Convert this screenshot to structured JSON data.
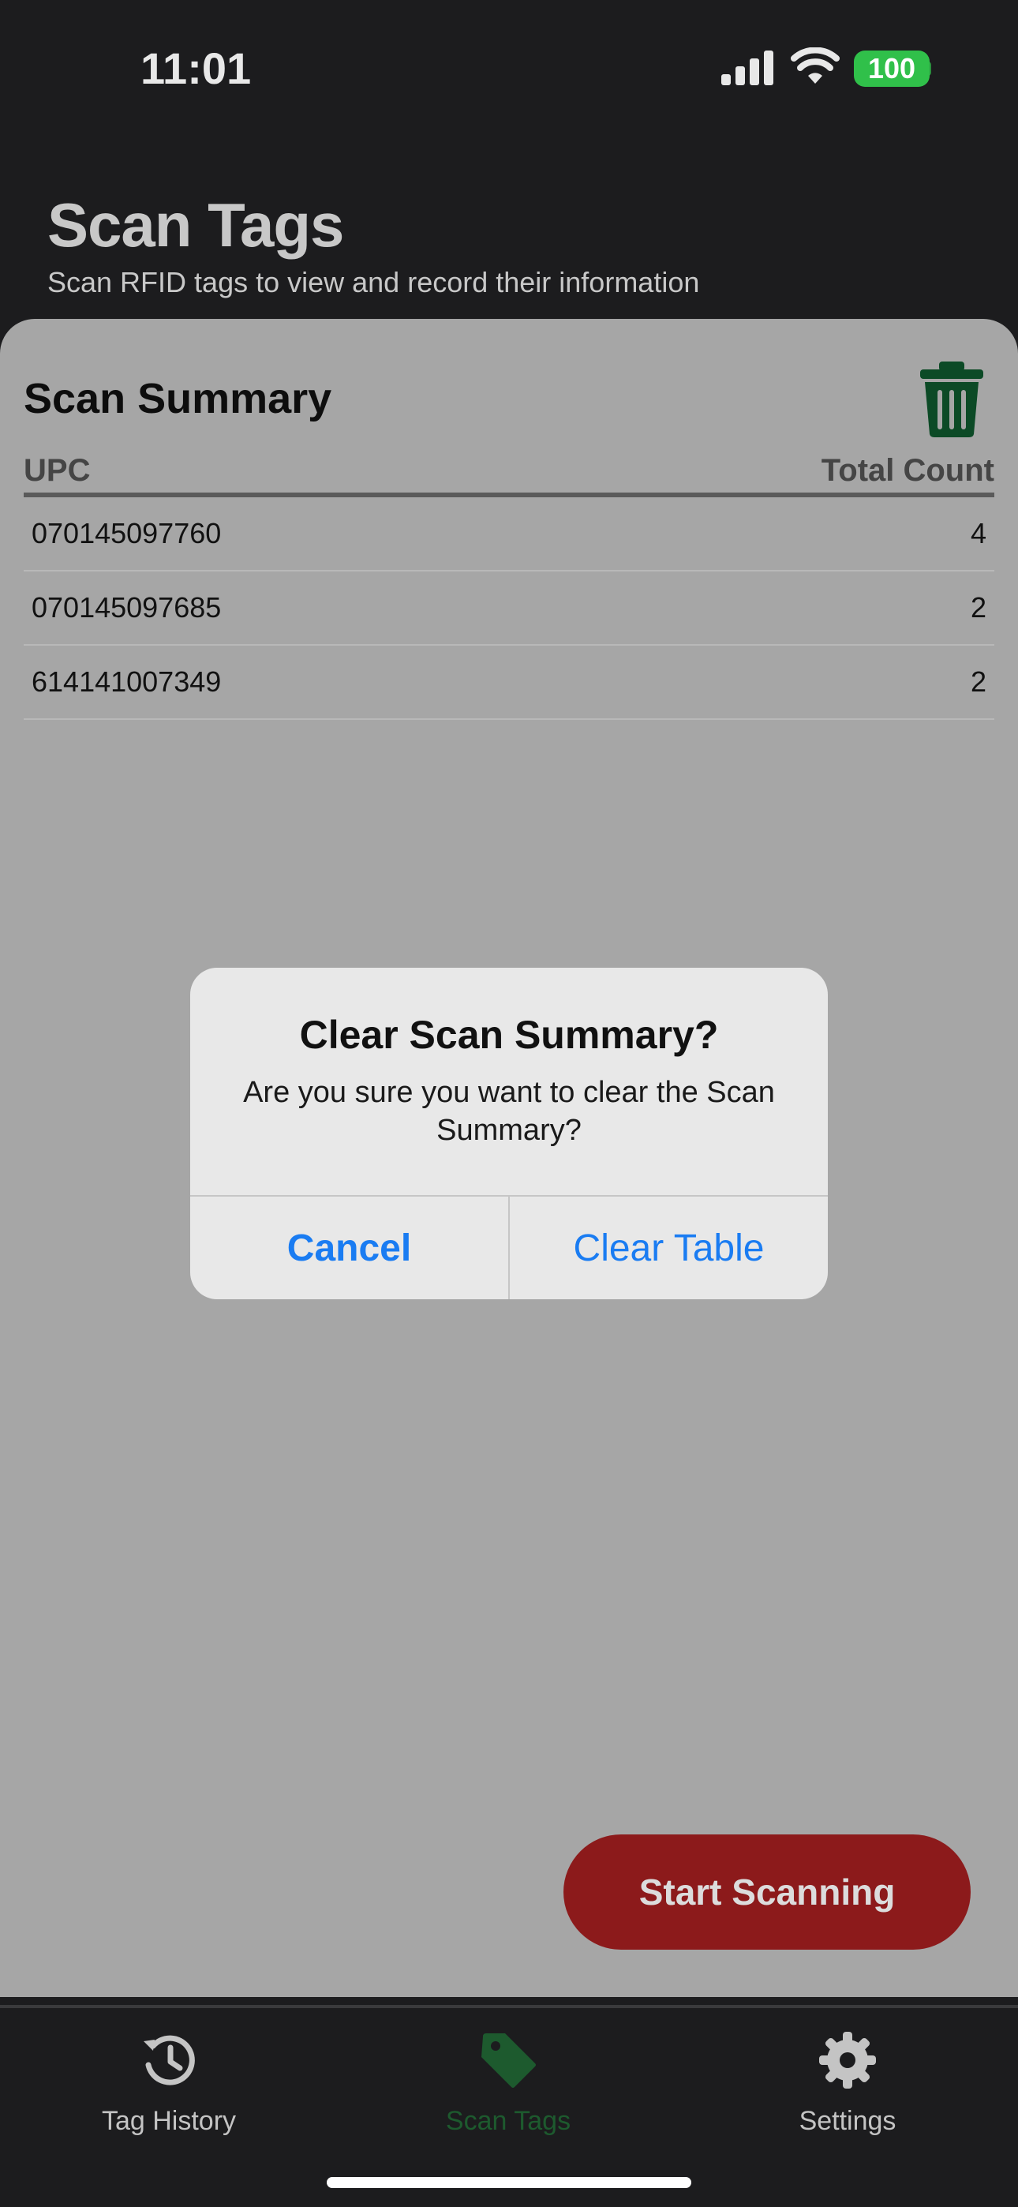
{
  "status_bar": {
    "time": "11:01",
    "battery": "100",
    "icons": [
      "signal-icon",
      "wifi-icon",
      "battery-icon"
    ]
  },
  "header": {
    "title": "Scan Tags",
    "subtitle": "Scan RFID tags to view and record their information"
  },
  "summary": {
    "title": "Scan Summary",
    "trash_icon": "trash-icon",
    "columns": [
      "UPC",
      "Total Count"
    ],
    "rows": [
      {
        "upc": "070145097760",
        "count": "4"
      },
      {
        "upc": "070145097685",
        "count": "2"
      },
      {
        "upc": "614141007349",
        "count": "2"
      }
    ]
  },
  "alert": {
    "title": "Clear Scan Summary?",
    "message": "Are you sure you want to clear the Scan Summary?",
    "cancel_label": "Cancel",
    "confirm_label": "Clear Table"
  },
  "scan_button": {
    "label": "Start Scanning"
  },
  "tabbar": {
    "items": [
      {
        "label": "Tag History",
        "icon": "history-icon"
      },
      {
        "label": "Scan Tags",
        "icon": "tag-icon",
        "selected": true
      },
      {
        "label": "Settings",
        "icon": "gear-icon"
      }
    ]
  },
  "colors": {
    "accent_green": "#1d5a2e",
    "scan_button": "#8c1a1b",
    "alert_button": "#1a7cf2",
    "battery": "#30c04a"
  }
}
